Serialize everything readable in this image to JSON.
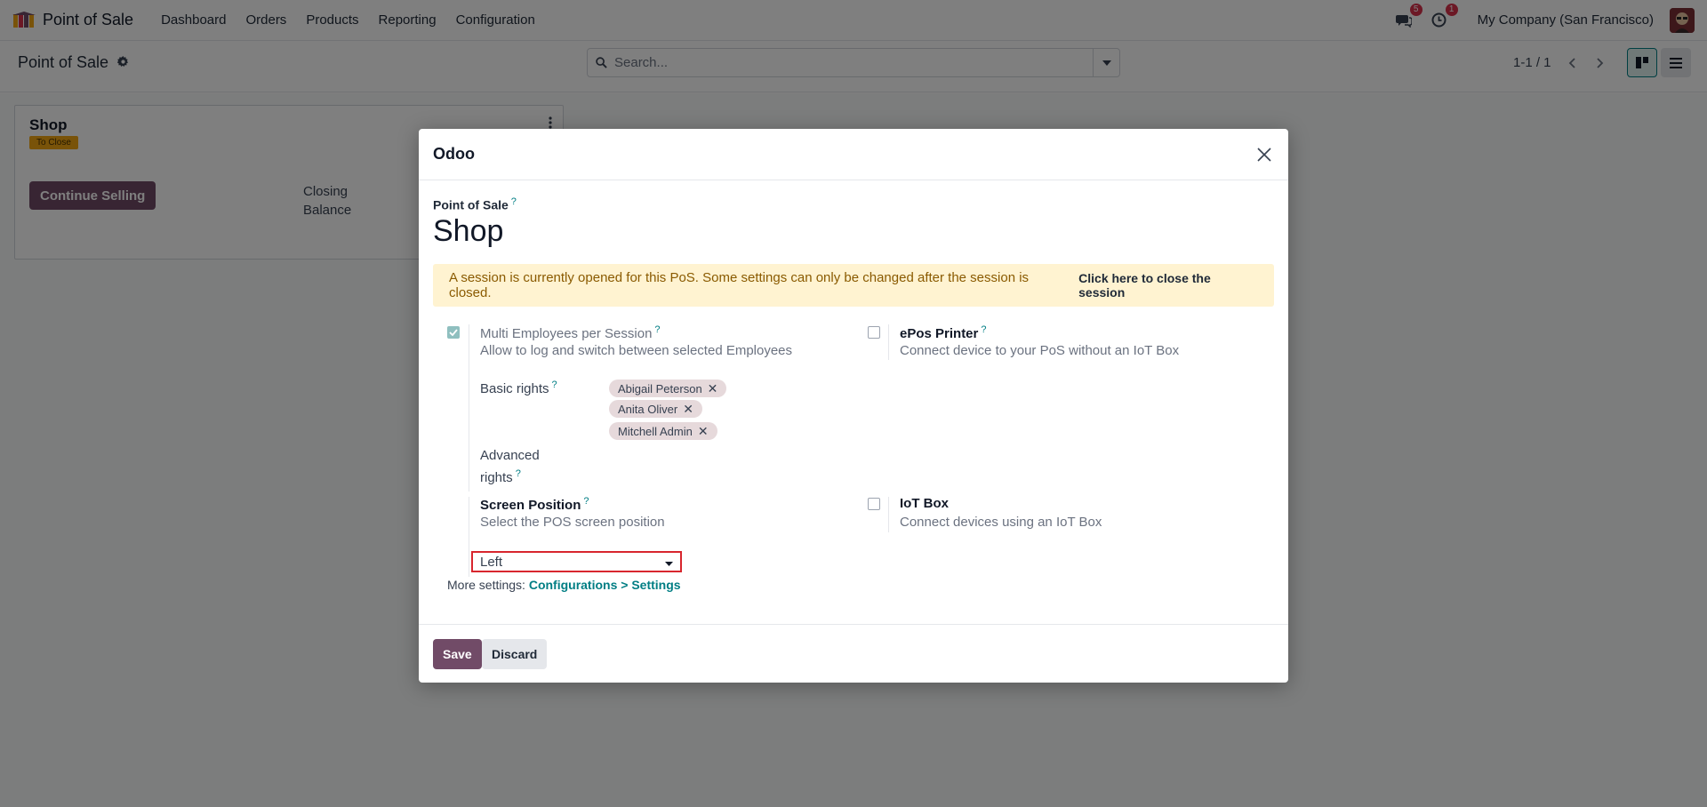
{
  "navbar": {
    "app_name": "Point of Sale",
    "menu": [
      "Dashboard",
      "Orders",
      "Products",
      "Reporting",
      "Configuration"
    ],
    "messages_count": "5",
    "activities_count": "1",
    "company": "My Company (San Francisco)"
  },
  "control_panel": {
    "breadcrumb": "Point of Sale",
    "search_placeholder": "Search...",
    "pager": "1-1 / 1"
  },
  "kanban": {
    "card_title": "Shop",
    "card_tag": "To Close",
    "continue_label": "Continue Selling",
    "closing_line1": "Closing",
    "closing_line2": "Balance"
  },
  "modal": {
    "title": "Odoo",
    "field_label": "Point of Sale",
    "help_mark": "?",
    "record_name": "Shop",
    "alert_text": "A session is currently opened for this PoS. Some settings can only be changed after the session is closed.",
    "alert_link": "Click here to close the session",
    "multi_employee": {
      "title": "Multi Employees per Session",
      "desc": "Allow to log and switch between selected Employees",
      "checked": true
    },
    "basic_rights_label": "Basic rights",
    "basic_rights_tags": [
      "Abigail Peterson",
      "Anita Oliver",
      "Mitchell Admin"
    ],
    "advanced_rights_line1": "Advanced",
    "advanced_rights_line2": "rights",
    "epos": {
      "title": "ePos Printer",
      "desc": "Connect device to your PoS without an IoT Box",
      "checked": false
    },
    "screen_position": {
      "title": "Screen Position",
      "desc": "Select the POS screen position",
      "value": "Left"
    },
    "iot": {
      "title": "IoT Box",
      "desc": "Connect devices using an IoT Box",
      "checked": false
    },
    "more_settings_label": "More settings:",
    "more_settings_link": "Configurations > Settings",
    "save_label": "Save",
    "discard_label": "Discard"
  },
  "colors": {
    "brand": "#714b67",
    "accent": "#017e84",
    "alert_bg": "#fff3d1",
    "highlight": "#d8262e"
  }
}
